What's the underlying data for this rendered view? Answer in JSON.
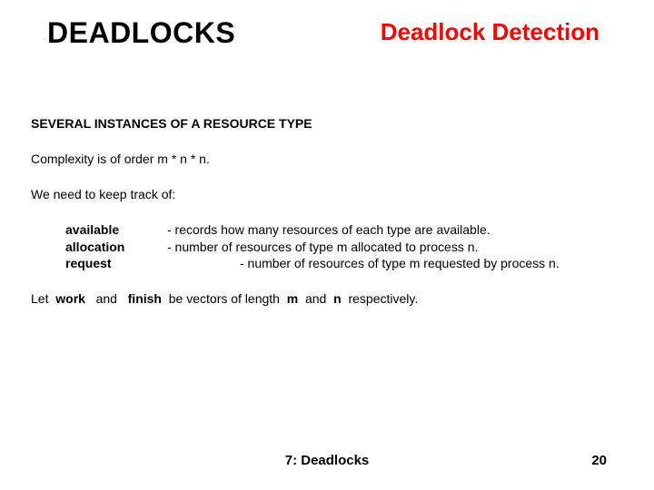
{
  "header": {
    "title_left": "DEADLOCKS",
    "title_right": "Deadlock Detection"
  },
  "section_heading": "SEVERAL INSTANCES OF A RESOURCE TYPE",
  "complexity_line": "Complexity is of order m * n * n.",
  "track_line": "We need to keep track of:",
  "defs": {
    "term1": "available",
    "desc1": "- records how many resources of each type are available.",
    "term2": "allocation",
    "desc2": "- number of resources of type m allocated to process n.",
    "term3": "request",
    "desc3": "- number of resources of type m requested by process n."
  },
  "let_line": {
    "let": "Let",
    "work": "work",
    "and": "and",
    "finish": "finish",
    "rest1": "be vectors of length",
    "m": "m",
    "and2": "and",
    "n": "n",
    "tail": "respectively."
  },
  "footer": {
    "center": "7: Deadlocks",
    "page": "20"
  }
}
